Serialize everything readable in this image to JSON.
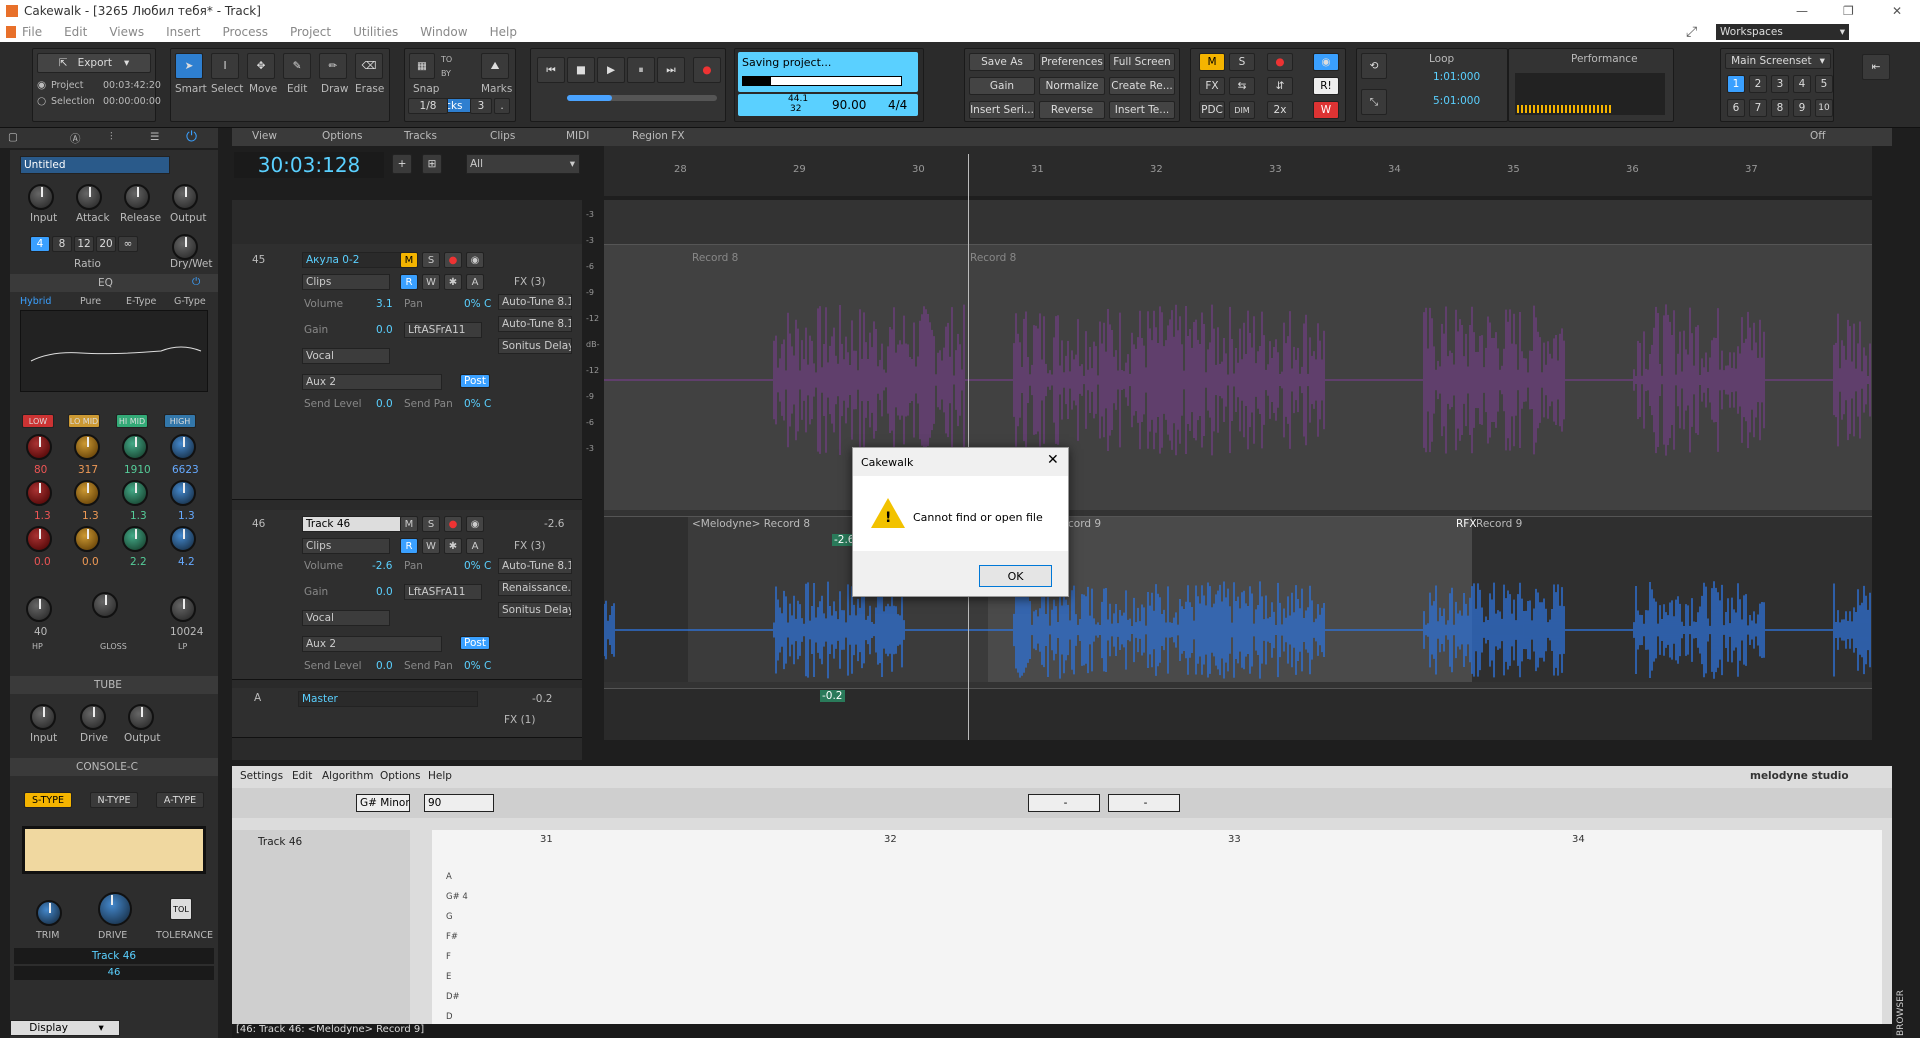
{
  "window": {
    "title": "Cakewalk - [3265 Любил тебя* - Track]"
  },
  "menu": [
    "File",
    "Edit",
    "Views",
    "Insert",
    "Process",
    "Project",
    "Utilities",
    "Window",
    "Help"
  ],
  "export": {
    "label": "Export",
    "project_label": "Project",
    "project_time": "00:03:42:20",
    "selection_label": "Selection",
    "selection_time": "00:00:00:00"
  },
  "tools": [
    "Smart",
    "Select",
    "Move",
    "Edit",
    "Draw",
    "Erase"
  ],
  "snap": {
    "label": "Snap",
    "ticks": "74 Ticks",
    "value": "1/8",
    "by": "3",
    "to": "TO",
    "by_label": "BY"
  },
  "marks": "Marks",
  "transport": {
    "status": "Saving project...",
    "sample_rate": "44.1",
    "bit_depth": "32",
    "tempo": "90.00",
    "meter": "4/4"
  },
  "actions": [
    "Save As",
    "Preferences",
    "Full Screen",
    "Gain",
    "Normalize",
    "Create Re...",
    "Insert Seri...",
    "Reverse",
    "Insert Te..."
  ],
  "mix": {
    "m": "M",
    "s": "S",
    "fx": "FX",
    "pdc": "PDC",
    "dim": "DIM",
    "x2": "2x",
    "ri": "R!",
    "w": "W"
  },
  "loop": {
    "label": "Loop",
    "start": "1:01:000",
    "end": "5:01:000"
  },
  "performance": {
    "label": "Performance"
  },
  "screenset": {
    "label": "Main Screenset",
    "numbers": [
      "1",
      "2",
      "3",
      "4",
      "5",
      "6",
      "7",
      "8",
      "9",
      "10"
    ]
  },
  "workspaces": "Workspaces",
  "track_menu": [
    "View",
    "Options",
    "Tracks",
    "Clips",
    "MIDI",
    "Region FX"
  ],
  "time_display": "30:03:128",
  "filter": "All",
  "ruler_marks": [
    "28",
    "29",
    "30",
    "31",
    "32",
    "33",
    "34",
    "35",
    "36",
    "37"
  ],
  "inspector": {
    "preset": "Untitled",
    "comp_knobs": [
      "Input",
      "Attack",
      "Release",
      "Output"
    ],
    "ratios": [
      "4",
      "8",
      "12",
      "20",
      "∞"
    ],
    "ratio_label": "Ratio",
    "drywet": "Dry/Wet",
    "eq_label": "EQ",
    "eq_modes": [
      "Hybrid",
      "Pure",
      "E-Type",
      "G-Type"
    ],
    "eq_bands": [
      "LOW",
      "LO MID",
      "HI MID",
      "HIGH"
    ],
    "eq_freqs": [
      "80",
      "317",
      "1910",
      "6623"
    ],
    "eq_q": [
      "1.3",
      "1.3",
      "1.3",
      "1.3"
    ],
    "eq_gain": [
      "0.0",
      "0.0",
      "2.2",
      "4.2"
    ],
    "hp": "40",
    "lp": "10024",
    "hp_label": "HP",
    "gloss": "GLOSS",
    "lp_label": "LP",
    "tube_label": "TUBE",
    "tube_knobs": [
      "Input",
      "Drive",
      "Output"
    ],
    "console_label": "CONSOLE-C",
    "types": [
      "S-TYPE",
      "N-TYPE",
      "A-TYPE"
    ],
    "console_knobs": [
      "TRIM",
      "DRIVE",
      "TOLERANCE"
    ],
    "tol": "TOL",
    "track_name": "Track 46",
    "track_num": "46",
    "display": "Display"
  },
  "tracks": [
    {
      "num": "45",
      "name": "Акула 0-2",
      "clips": "Clips",
      "volume_label": "Volume",
      "volume": "3.1",
      "pan_label": "Pan",
      "pan": "0% C",
      "gain_label": "Gain",
      "gain": "0.0",
      "input": "LftASFrA11",
      "category": "Vocal",
      "fx": "FX (3)",
      "fx_list": [
        "Auto-Tune 8.1",
        "Auto-Tune 8.1",
        "Sonitus Delay"
      ],
      "send": "Aux 2",
      "send_level_label": "Send Level",
      "send_level": "0.0",
      "send_pan_label": "Send Pan",
      "send_pan": "0% C",
      "post": "Post",
      "gain_db": ""
    },
    {
      "num": "46",
      "name": "Track 46",
      "clips": "Clips",
      "volume_label": "Volume",
      "volume": "-2.6",
      "pan_label": "Pan",
      "pan": "0% C",
      "gain_label": "Gain",
      "gain": "0.0",
      "input": "LftASFrA11",
      "category": "Vocal",
      "fx": "FX (3)",
      "fx_list": [
        "Auto-Tune 8.1",
        "Renaissance...",
        "Sonitus Delay"
      ],
      "send": "Aux 2",
      "send_level_label": "Send Level",
      "send_level": "0.0",
      "send_pan_label": "Send Pan",
      "send_pan": "0% C",
      "post": "Post",
      "gain_db": "-2.6"
    }
  ],
  "master": {
    "letter": "A",
    "name": "Master",
    "value": "-0.2",
    "fx": "FX (1)"
  },
  "clips": {
    "t45a": "Record 8",
    "t45b": "Record 8",
    "t46a": "<Melodyne> Record 8",
    "t46b": "cord 9",
    "t46c": "Record 9",
    "rfx": "RFX",
    "marker1": "-2.6",
    "marker2": "-0.2"
  },
  "db_scale": [
    "-3",
    "-3",
    "-6",
    "-9",
    "-12",
    "dB-",
    "-12",
    "-9",
    "-6",
    "-3"
  ],
  "melodyne": {
    "menu": [
      "Settings",
      "Edit",
      "Algorithm",
      "Options",
      "Help"
    ],
    "brand": "melodyne studio",
    "key": "G# Minor",
    "tempo": "90",
    "track": "Track 46",
    "bars": [
      "31",
      "32",
      "33",
      "34"
    ],
    "notes": [
      "A",
      "G# 4",
      "G",
      "F#",
      "F",
      "E",
      "D#",
      "D"
    ],
    "dash1": "-",
    "dash2": "-"
  },
  "dialog": {
    "title": "Cakewalk",
    "message": "Cannot find or open file",
    "ok": "OK"
  },
  "status": "[46: Track 46: <Melodyne> Record 9]",
  "browser": "BROWSER",
  "loop_off": "Off"
}
